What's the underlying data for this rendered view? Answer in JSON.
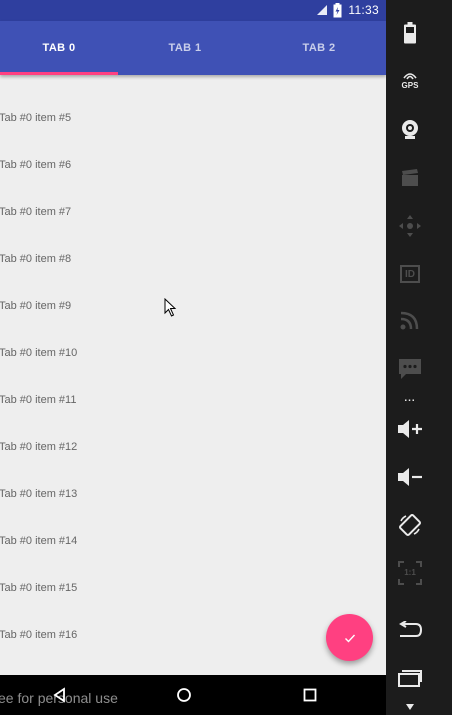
{
  "status_bar": {
    "time": "11:33"
  },
  "tabs": [
    {
      "label": "TAB 0",
      "active": true
    },
    {
      "label": "TAB 1",
      "active": false
    },
    {
      "label": "TAB 2",
      "active": false
    }
  ],
  "list": {
    "items": [
      "Tab #0 item #5",
      "Tab #0 item #6",
      "Tab #0 item #7",
      "Tab #0 item #8",
      "Tab #0 item #9",
      "Tab #0 item #10",
      "Tab #0 item #11",
      "Tab #0 item #12",
      "Tab #0 item #13",
      "Tab #0 item #14",
      "Tab #0 item #15",
      "Tab #0 item #16"
    ]
  },
  "nav_bar": {
    "watermark": "ee for personal use"
  },
  "emulator_toolbar": {
    "gps_label": "GPS",
    "id_label": "ID",
    "scale_label": "1:1",
    "more_dots": "..."
  },
  "colors": {
    "primary": "#3f51b5",
    "primary_dark": "#2f3f9f",
    "accent": "#ff4081",
    "background": "#eeeeee"
  }
}
